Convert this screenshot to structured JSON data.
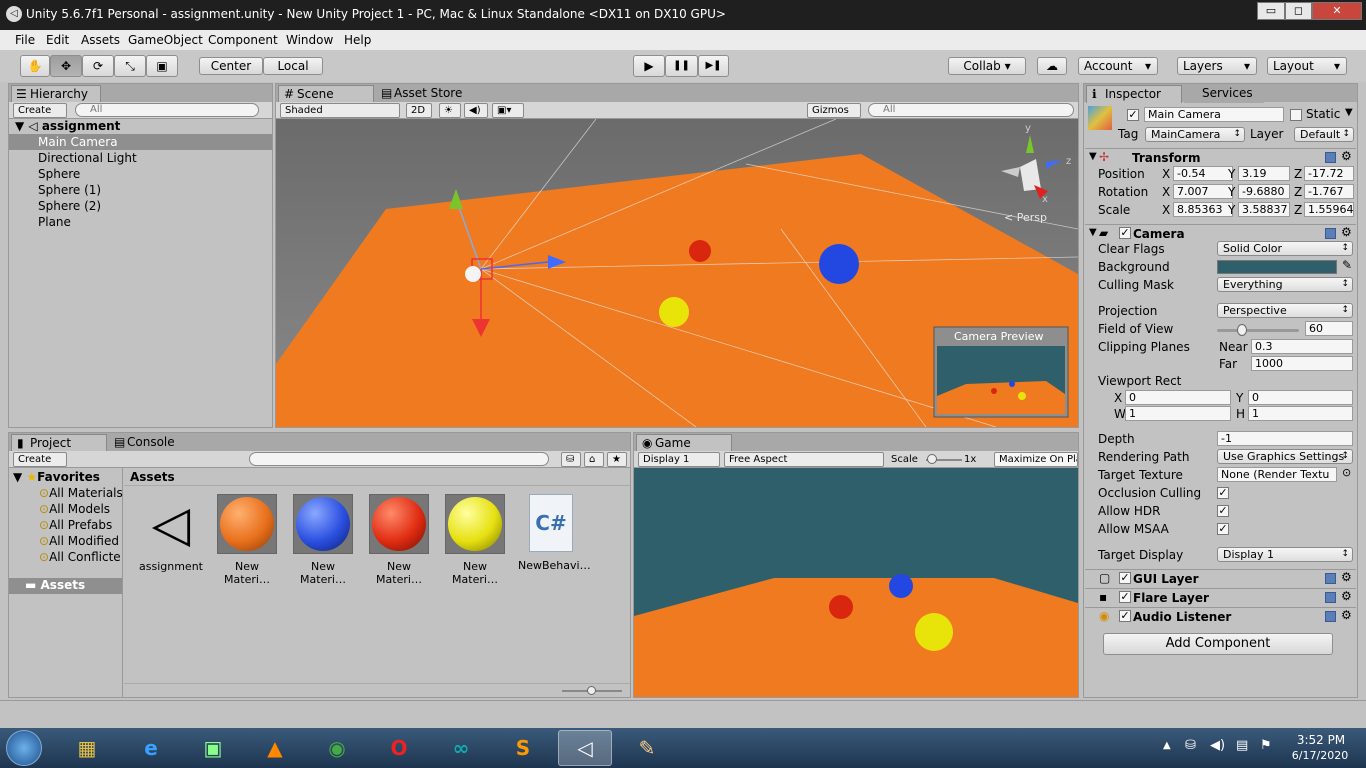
{
  "window": {
    "title": "Unity 5.6.7f1 Personal - assignment.unity - New Unity Project 1 - PC, Mac & Linux Standalone <DX11 on DX10 GPU>",
    "minimize": "▭",
    "maximize": "◻",
    "close": "✕"
  },
  "menu": [
    "File",
    "Edit",
    "Assets",
    "GameObject",
    "Component",
    "Window",
    "Help"
  ],
  "toolbar": {
    "pivot": "Center",
    "space": "Local",
    "play_icon": "▶",
    "pause_icon": "❚❚",
    "step_icon": "▶❚",
    "collab": "Collab ▾",
    "cloud_icon": "☁",
    "account": "Account",
    "layers": "Layers",
    "layout": "Layout",
    "tools": [
      "✋",
      "✥",
      "⟳",
      "⤡",
      "▣"
    ]
  },
  "hierarchy": {
    "tab": "Hierarchy",
    "create": "Create",
    "search_placeholder": "All",
    "scene": "assignment",
    "items": [
      "Main Camera",
      "Directional Light",
      "Sphere",
      "Sphere (1)",
      "Sphere (2)",
      "Plane"
    ],
    "selected": "Main Camera"
  },
  "scene": {
    "tabs": [
      "Scene",
      "Asset Store"
    ],
    "shading": "Shaded",
    "mode2d": "2D",
    "gizmos": "Gizmos",
    "search_placeholder": "All",
    "persp": "< Persp",
    "camera_preview": "Camera Preview",
    "axis_y": "y",
    "axis_z": "z",
    "axis_x": "x"
  },
  "project": {
    "tabs": [
      "Project",
      "Console"
    ],
    "create": "Create",
    "favorites": "Favorites",
    "fav_items": [
      "All Materials",
      "All Models",
      "All Prefabs",
      "All Modified",
      "All Conflicte"
    ],
    "assets_folder": "Assets",
    "assets_header": "Assets",
    "assets": [
      {
        "name": "assignment",
        "kind": "unity",
        "color": ""
      },
      {
        "name": "New Materi…",
        "kind": "material",
        "color": "#e8701c"
      },
      {
        "name": "New Materi…",
        "kind": "material",
        "color": "#2b4fe0"
      },
      {
        "name": "New Materi…",
        "kind": "material",
        "color": "#e02c12"
      },
      {
        "name": "New Materi…",
        "kind": "material",
        "color": "#e6e010"
      },
      {
        "name": "NewBehavi…",
        "kind": "script",
        "color": ""
      }
    ],
    "script_icon": "C#"
  },
  "game": {
    "tab": "Game",
    "display": "Display 1",
    "aspect": "Free Aspect",
    "scale_label": "Scale",
    "scale_value": "1x",
    "maximize": "Maximize On Pla"
  },
  "inspector": {
    "tabs": [
      "Inspector",
      "Services"
    ],
    "object_name": "Main Camera",
    "static": "Static",
    "tag_label": "Tag",
    "tag": "MainCamera",
    "layer_label": "Layer",
    "layer": "Default",
    "transform": {
      "title": "Transform",
      "position": {
        "label": "Position",
        "x": "-0.54",
        "y": "3.19",
        "z": "-17.72"
      },
      "rotation": {
        "label": "Rotation",
        "x": "7.007",
        "y": "-9.6880",
        "z": "-1.767"
      },
      "scale": {
        "label": "Scale",
        "x": "8.85363",
        "y": "3.58837",
        "z": "1.55964"
      }
    },
    "camera": {
      "title": "Camera",
      "clear_flags": {
        "label": "Clear Flags",
        "value": "Solid Color"
      },
      "background": {
        "label": "Background",
        "color": "#2e5f6b"
      },
      "culling_mask": {
        "label": "Culling Mask",
        "value": "Everything"
      },
      "projection": {
        "label": "Projection",
        "value": "Perspective"
      },
      "fov": {
        "label": "Field of View",
        "value": "60",
        "fraction": 0.3
      },
      "clipping": {
        "label": "Clipping Planes",
        "near_label": "Near",
        "near": "0.3",
        "far_label": "Far",
        "far": "1000"
      },
      "viewport": {
        "label": "Viewport Rect",
        "x": "0",
        "y": "0",
        "w": "1",
        "h": "1"
      },
      "depth": {
        "label": "Depth",
        "value": "-1"
      },
      "rendering_path": {
        "label": "Rendering Path",
        "value": "Use Graphics Settings"
      },
      "target_texture": {
        "label": "Target Texture",
        "value": "None (Render Textu"
      },
      "occlusion": {
        "label": "Occlusion Culling"
      },
      "hdr": {
        "label": "Allow HDR"
      },
      "msaa": {
        "label": "Allow MSAA"
      },
      "target_display": {
        "label": "Target Display",
        "value": "Display 1"
      }
    },
    "components": [
      "GUI Layer",
      "Flare Layer",
      "Audio Listener"
    ],
    "add_component": "Add Component"
  },
  "taskbar": {
    "time": "3:52 PM",
    "date": "6/17/2020",
    "apps": [
      "explorer",
      "ie",
      "terminal",
      "vlc",
      "chrome",
      "opera",
      "arduino",
      "sublime",
      "unity",
      "paint"
    ]
  }
}
